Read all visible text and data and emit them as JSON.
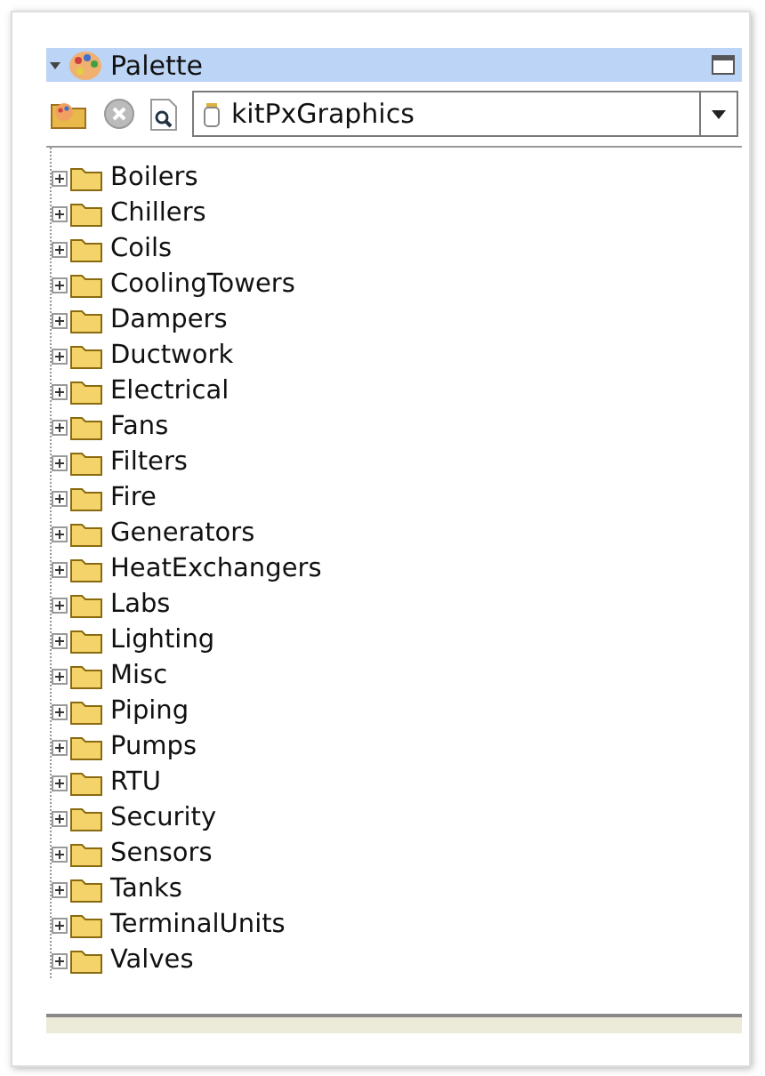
{
  "palette": {
    "title": "Palette",
    "source": {
      "value": "kitPxGraphics"
    }
  },
  "tree": {
    "items": [
      {
        "label": "Boilers",
        "expanded": false
      },
      {
        "label": "Chillers",
        "expanded": false
      },
      {
        "label": "Coils",
        "expanded": false
      },
      {
        "label": "CoolingTowers",
        "expanded": false
      },
      {
        "label": "Dampers",
        "expanded": false
      },
      {
        "label": "Ductwork",
        "expanded": false
      },
      {
        "label": "Electrical",
        "expanded": false
      },
      {
        "label": "Fans",
        "expanded": false
      },
      {
        "label": "Filters",
        "expanded": false
      },
      {
        "label": "Fire",
        "expanded": false
      },
      {
        "label": "Generators",
        "expanded": false
      },
      {
        "label": "HeatExchangers",
        "expanded": false
      },
      {
        "label": "Labs",
        "expanded": false
      },
      {
        "label": "Lighting",
        "expanded": false
      },
      {
        "label": "Misc",
        "expanded": false
      },
      {
        "label": "Piping",
        "expanded": false
      },
      {
        "label": "Pumps",
        "expanded": false
      },
      {
        "label": "RTU",
        "expanded": false
      },
      {
        "label": "Security",
        "expanded": false
      },
      {
        "label": "Sensors",
        "expanded": false
      },
      {
        "label": "Tanks",
        "expanded": false
      },
      {
        "label": "TerminalUnits",
        "expanded": false
      },
      {
        "label": "Valves",
        "expanded": false
      }
    ]
  }
}
